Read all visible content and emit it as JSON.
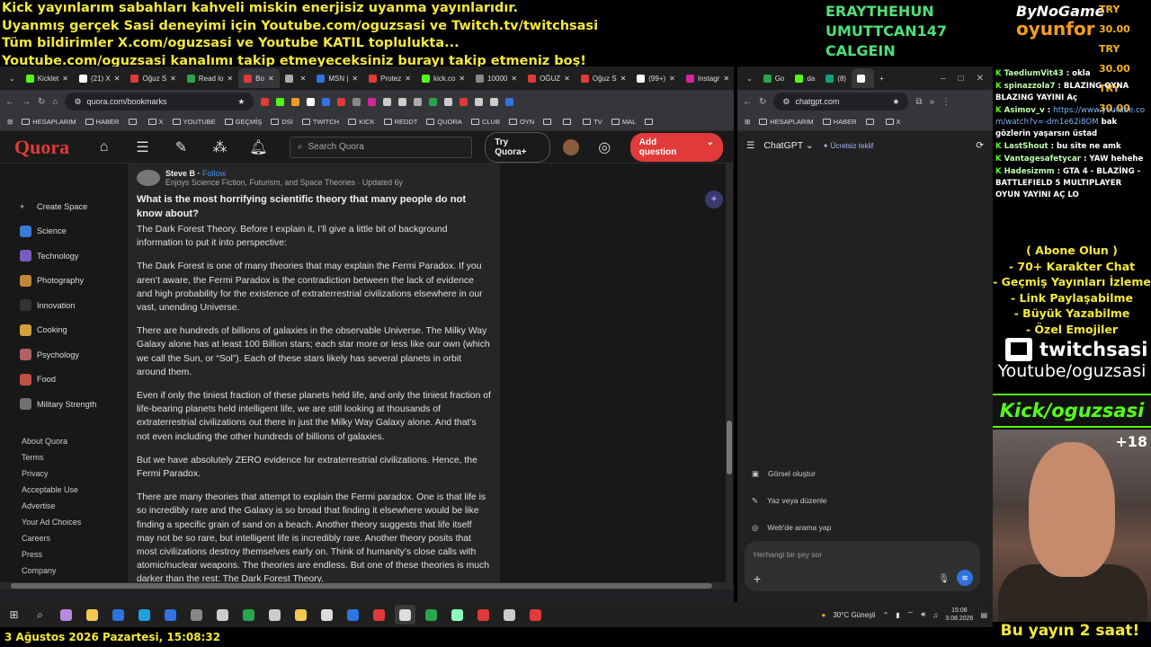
{
  "overlay": {
    "lines": [
      "Kick yayınlarım sabahları kahveli miskin enerjisiz uyanma yayınlarıdır.",
      "Uyanmış gerçek Sasi deneyimi için Youtube.com/oguzsasi ve Twitch.tv/twitchsasi",
      "Tüm bildirimler X.com/oguzsasi ve Youtube KATIL toplulukta...",
      "Youtube.com/oguzsasi kanalımı takip etmeyeceksiniz burayı takip etmeniz boş!"
    ],
    "names": [
      "ERAYTHEHUN",
      "UMUTTCAN147",
      "CALGEIN"
    ],
    "brand": {
      "top": "ByNoGame",
      "bottom": "oyunfor"
    },
    "tries": [
      "TRY 30.00",
      "TRY 30.00",
      "TRY 30.00"
    ],
    "bottom_date": "3 Ağustos 2026 Pazartesi, 15:08:32",
    "bottom_right": "Bu yayın 2 saat!"
  },
  "left_browser": {
    "tabs": [
      {
        "label": "Kicklet",
        "color": "#53fc18"
      },
      {
        "label": "(21) X",
        "color": "#ffffff"
      },
      {
        "label": "Oğuz S",
        "color": "#e03a3a"
      },
      {
        "label": "Read lo",
        "color": "#2aa44f"
      },
      {
        "label": "Bo",
        "color": "#e03a3a"
      },
      {
        "label": "",
        "color": "#aaaaaa"
      },
      {
        "label": "MSN |",
        "color": "#2f74e0"
      },
      {
        "label": "Protez",
        "color": "#e03a3a"
      },
      {
        "label": "kick.co",
        "color": "#53fc18"
      },
      {
        "label": "10000",
        "color": "#888888"
      },
      {
        "label": "OĞUZ",
        "color": "#e03a3a"
      },
      {
        "label": "Oğuz S",
        "color": "#e03a3a"
      },
      {
        "label": "(99+)",
        "color": "#ffffff"
      },
      {
        "label": "Instagr",
        "color": "#d6249f"
      }
    ],
    "url": "quora.com/bookmarks",
    "bookmarks": [
      "HESAPLARIM",
      "HABER",
      "",
      "X",
      "YOUTUBE",
      "GEÇMİŞ",
      "DSİ",
      "TWITCH",
      "KICK",
      "REDDT",
      "QUORA",
      "CLUB",
      "OYN",
      "",
      "",
      "TV",
      "MAL",
      ""
    ]
  },
  "quora": {
    "logo": "Quora",
    "search_placeholder": "Search Quora",
    "try_label": "Try Quora+",
    "add_question": "Add question",
    "sidebar": [
      {
        "label": "Create Space",
        "color": "#444444"
      },
      {
        "label": "Science",
        "color": "#3a7bd5"
      },
      {
        "label": "Technology",
        "color": "#7a5cc0"
      },
      {
        "label": "Photography",
        "color": "#c0873a"
      },
      {
        "label": "Innovation",
        "color": "#333333"
      },
      {
        "label": "Cooking",
        "color": "#d5a03a"
      },
      {
        "label": "Psychology",
        "color": "#b06060"
      },
      {
        "label": "Food",
        "color": "#c05040"
      },
      {
        "label": "Military Strength",
        "color": "#707070"
      }
    ],
    "footer_links": [
      "About Quora",
      "Terms",
      "Privacy",
      "Acceptable Use",
      "Advertise",
      "Your Ad Choices",
      "Careers",
      "Press",
      "Company"
    ],
    "author_name": "Steve B",
    "follow_label": "Follow",
    "author_meta": "Enjoys Science Fiction, Futurism, and Space Theories · Updated 6y",
    "question": "What is the most horrifying scientific theory that many people do not know about?",
    "paragraphs": [
      "The Dark Forest Theory. Before I explain it, I’ll give a little bit of background information to put it into perspective:",
      "The Dark Forest is one of many theories that may explain the Fermi Paradox. If you aren’t aware, the Fermi Paradox is the contradiction between the lack of evidence and high probability for the existence of extraterrestrial civilizations elsewhere in our vast, unending Universe.",
      "There are hundreds of billions of galaxies in the observable Universe. The Milky Way Galaxy alone has at least 100 Billion stars; each star more or less like our own (which we call the Sun, or “Sol”). Each of these stars likely has several planets in orbit around them.",
      "Even if only the tiniest fraction of these planets held life, and only the tiniest fraction of life-bearing planets held intelligent life, we are still looking at thousands of extraterrestrial civilizations out there in just the Milky Way Galaxy alone. And that’s not even including the other hundreds of billions of galaxies.",
      "But we have absolutely ZERO evidence for extraterrestrial civilizations. Hence, the Fermi Paradox.",
      "There are many theories that attempt to explain the Fermi paradox. One is that life is so incredibly rare and the Galaxy is so broad that finding it elsewhere would be like finding a specific grain of sand on a beach. Another theory suggests that life itself may not be so rare, but intelligent life is incredibly rare. Another theory posits that most civilizations destroy themselves early on. Think of humanity’s close calls with atomic/nuclear weapons. The theories are endless. But one of these theories is much darker than the rest: The Dark Forest Theory."
    ]
  },
  "right_browser": {
    "tabs": [
      {
        "label": "Go",
        "color": "#2aa44f"
      },
      {
        "label": "da",
        "color": "#53fc18"
      },
      {
        "label": "(8)",
        "color": "#10a37f"
      },
      {
        "label": "",
        "color": "#ffffff"
      }
    ],
    "url": "chatgpt.com",
    "bookmarks": [
      "HESAPLARIM",
      "HABER",
      "",
      "X"
    ],
    "model": "ChatGPT",
    "free_offer": "Ücretsiz teklif",
    "suggestions": [
      "Görsel oluştur",
      "Yaz veya düzenle",
      "Web'de arama yap"
    ],
    "placeholder": "Herhangi bir şey sor"
  },
  "taskbar": {
    "weather": "30°C  Güneşli",
    "time": "15:08",
    "date": "3.08.2026"
  },
  "chat": [
    {
      "user": "TaediumVit43",
      "text": "okla"
    },
    {
      "user": "spinazzola7",
      "text": "BLAZING OYNA BLAZING YAYINI Aç"
    },
    {
      "user": "Asimov_v",
      "text": "",
      "link": "https://www.youtube.com/watch?v=-dm1e62i8OM",
      "after": "bak gözlerin yaşarsın üstad"
    },
    {
      "user": "LastShout",
      "text": "bu site ne amk"
    },
    {
      "user": "Vantagesafetycar",
      "text": "YAW hehehe"
    },
    {
      "user": "Hadesizmm",
      "text": "GTA 4 - BLAZİNG - BATTLEFIELD 5 MULTIPLAYER OYUN YAYINI AÇ LO"
    }
  ],
  "promo": [
    "( Abone Olun )",
    "- 70+ Karakter Chat",
    "- Geçmiş Yayınları İzleme",
    "- Link Paylaşabilme",
    "- Büyük Yazabilme",
    "- Özel Emojiler"
  ],
  "twitch_name": "twitchsasi",
  "youtube_name": "Youtube/oguzsasi",
  "kick_name": "Kick/oguzsasi",
  "cam_badge": "+18"
}
